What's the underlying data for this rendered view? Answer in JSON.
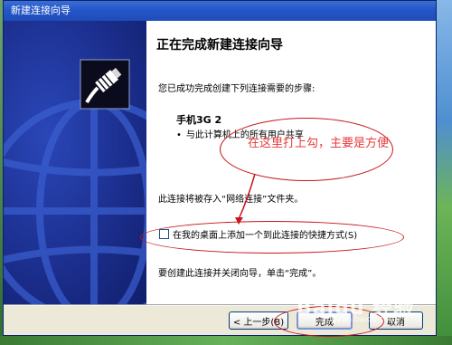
{
  "window": {
    "title": "新建连接向导"
  },
  "content": {
    "heading": "正在完成新建连接向导",
    "intro": "您已成功完成创建下列连接需要的步骤:",
    "connection_name": "手机3G 2",
    "bullet": "•",
    "share_item": "与此计算机上的所有用户共享",
    "save_location": "此连接将被存入“网络连接”文件夹。",
    "shortcut_checkbox_label": "在我的桌面上添加一个到此连接的快捷方式(S)",
    "shortcut_checked": false,
    "finish_instruction": "要创建此连接并关闭向导，单击“完成”。"
  },
  "annotation": {
    "note": "在这里打上勾，主要是方便"
  },
  "buttons": {
    "back": "< 上一步(B)",
    "finish": "完成",
    "cancel": "取消"
  },
  "watermark": {
    "logo": "Baidu 经验",
    "url": "jingyan.baidu.com"
  },
  "colors": {
    "titlebar": "#2456c9",
    "left_panel": "#1c2f8f",
    "annotation": "#c8161d"
  },
  "icons": {
    "wizard": "network-cable-icon"
  }
}
